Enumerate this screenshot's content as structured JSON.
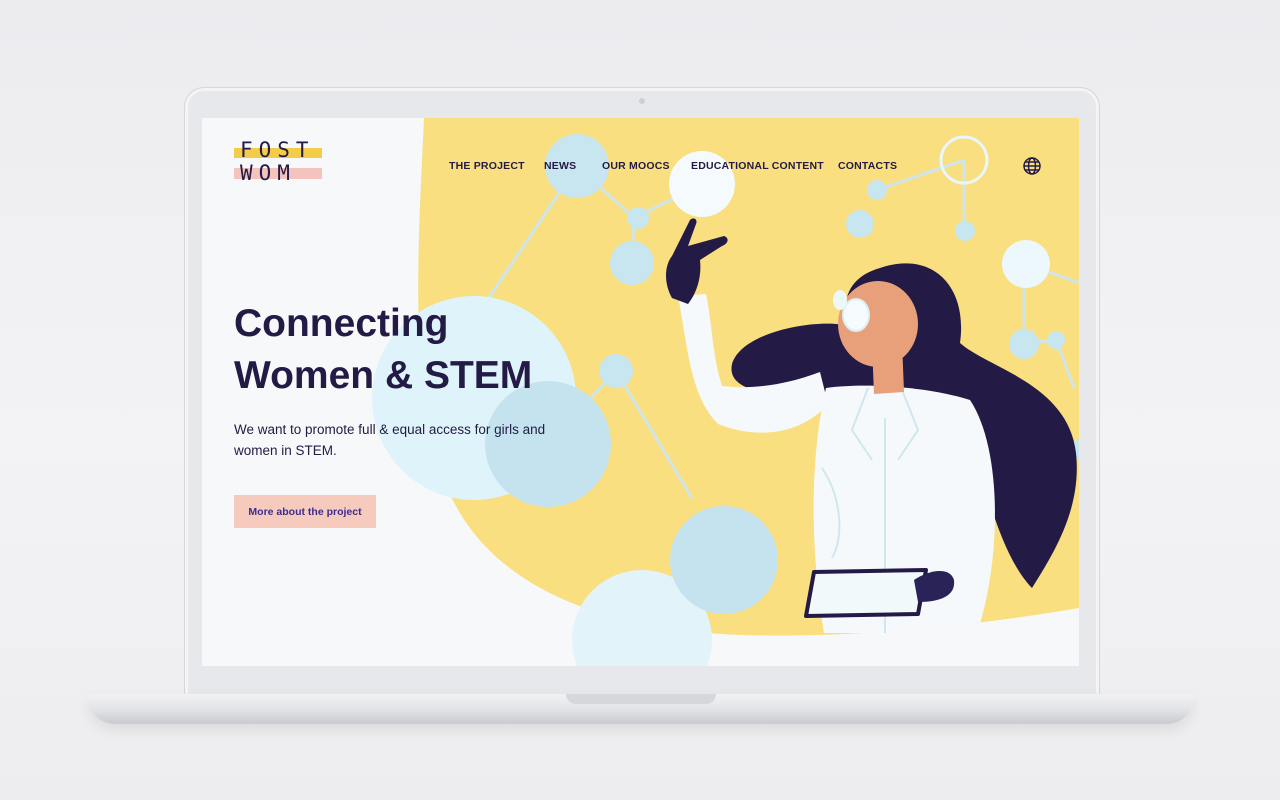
{
  "logo": {
    "line1": "FOST",
    "line2": "WOM"
  },
  "nav": {
    "items": [
      {
        "label": "THE PROJECT"
      },
      {
        "label": "NEWS"
      },
      {
        "label": "OUR MOOCS"
      },
      {
        "label": "EDUCATIONAL CONTENT"
      },
      {
        "label": "CONTACTS"
      }
    ],
    "language_icon": "globe-icon"
  },
  "hero": {
    "title_line1": "Connecting",
    "title_line2": "Women & STEM",
    "subtitle": "We want to promote full & equal access for girls and women in STEM.",
    "cta_label": "More about the project"
  },
  "colors": {
    "brand_navy": "#231a45",
    "accent_yellow": "#f9df80",
    "molecule_blue": "#c7e6f0",
    "cta_pink": "#f6cbbd"
  }
}
